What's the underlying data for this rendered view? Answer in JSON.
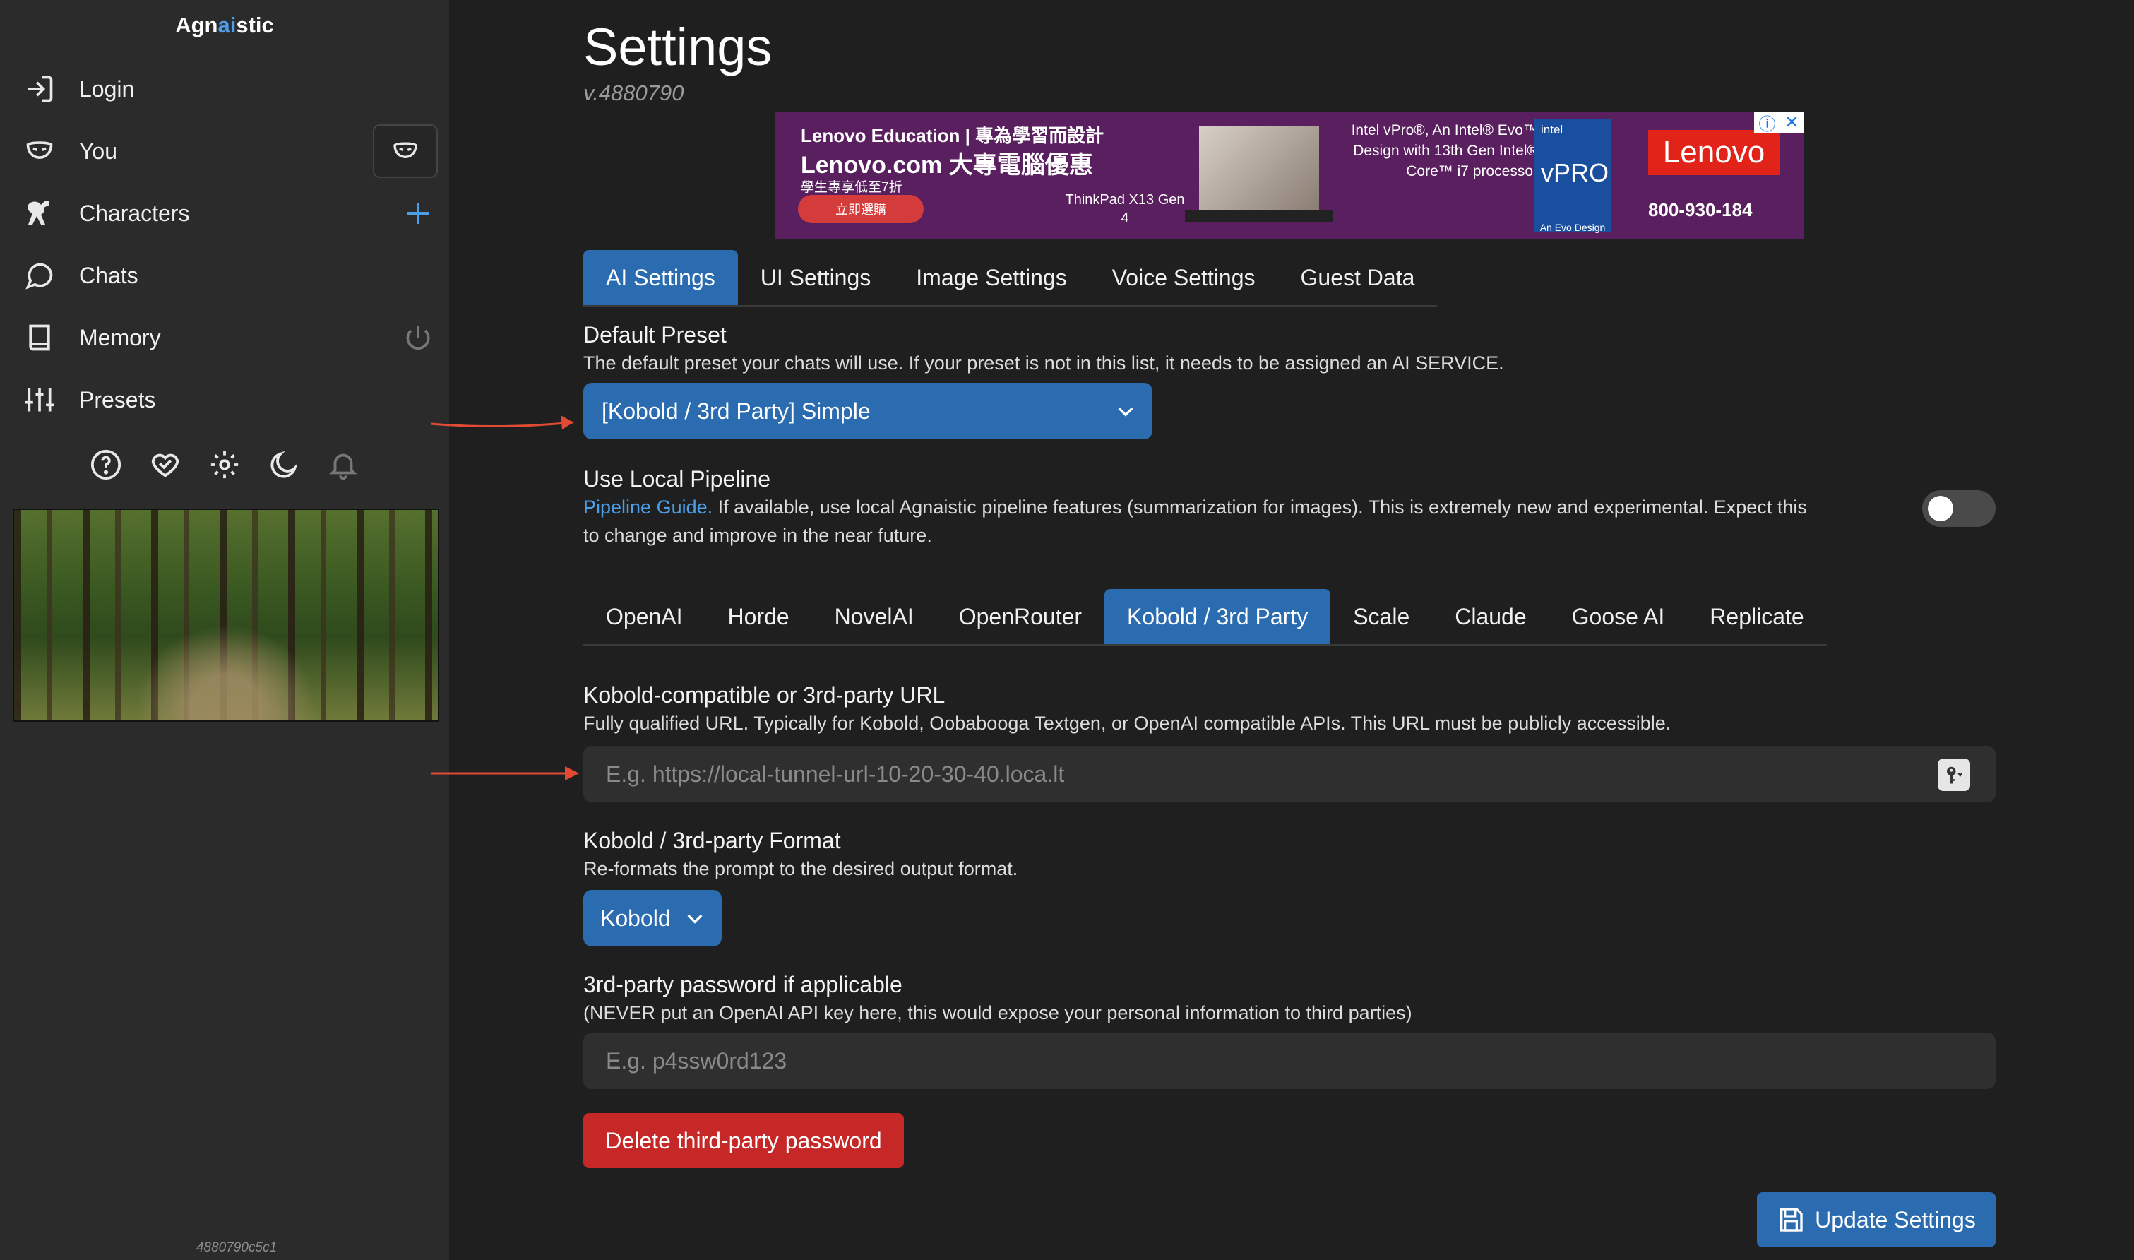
{
  "sidebar": {
    "brand_prefix": "Agn",
    "brand_highlight": "ai",
    "brand_suffix": "stic",
    "items": [
      {
        "label": "Login",
        "icon": "login-icon"
      },
      {
        "label": "You",
        "icon": "mask-icon"
      },
      {
        "label": "Characters",
        "icon": "characters-icon"
      },
      {
        "label": "Chats",
        "icon": "chat-bubble-icon"
      },
      {
        "label": "Memory",
        "icon": "book-icon"
      },
      {
        "label": "Presets",
        "icon": "sliders-icon"
      }
    ],
    "bottom_icons": [
      "help-icon",
      "heart-handshake-icon",
      "gear-icon",
      "moon-icon",
      "bell-icon"
    ],
    "build_hash": "4880790c5c1"
  },
  "header": {
    "title": "Settings",
    "version": "v.4880790"
  },
  "ad": {
    "line1": "Lenovo Education | 專為學習而設計",
    "line2": "Lenovo.com 大專電腦優惠",
    "line3": "學生專享低至7折",
    "button": "立即選購",
    "model": "ThinkPad X13 Gen 4",
    "promo": "Intel vPro®, An Intel® Evo™ Design with 13th Gen Intel® Core™ i7 processor",
    "intel": "intel",
    "vpro": "vPRO",
    "evo": "An Evo Design",
    "brand": "Lenovo",
    "phone": "800-930-184"
  },
  "main_tabs": [
    "AI Settings",
    "UI Settings",
    "Image Settings",
    "Voice Settings",
    "Guest Data"
  ],
  "default_preset": {
    "label": "Default Preset",
    "help": "The default preset your chats will use. If your preset is not in this list, it needs to be assigned an AI SERVICE.",
    "value": "[Kobold / 3rd Party] Simple"
  },
  "local_pipeline": {
    "label": "Use Local Pipeline",
    "link": "Pipeline Guide.",
    "help_line1": " If available, use local Agnaistic pipeline features (summarization for images). This is extremely new and experimental. Expect this",
    "help_line2": "to change and improve in the near future.",
    "enabled": false
  },
  "service_tabs": [
    "OpenAI",
    "Horde",
    "NovelAI",
    "OpenRouter",
    "Kobold / 3rd Party",
    "Scale",
    "Claude",
    "Goose AI",
    "Replicate"
  ],
  "kobold_url": {
    "label": "Kobold-compatible or 3rd-party URL",
    "help": "Fully qualified URL. Typically for Kobold, Oobabooga Textgen, or OpenAI compatible APIs. This URL must be publicly accessible.",
    "placeholder": "E.g. https://local-tunnel-url-10-20-30-40.loca.lt",
    "value": ""
  },
  "kobold_format": {
    "label": "Kobold / 3rd-party Format",
    "help": "Re-formats the prompt to the desired output format.",
    "value": "Kobold"
  },
  "password": {
    "label": "3rd-party password if applicable",
    "help": "(NEVER put an OpenAI API key here, this would expose your personal information to third parties)",
    "placeholder": "E.g. p4ssw0rd123",
    "value": ""
  },
  "buttons": {
    "delete_password": "Delete third-party password",
    "update_settings": "Update Settings"
  },
  "colors": {
    "accent": "#2b6cb0",
    "danger": "#c62828",
    "link": "#4d9ee8",
    "annotation_arrow": "#e24a33"
  }
}
